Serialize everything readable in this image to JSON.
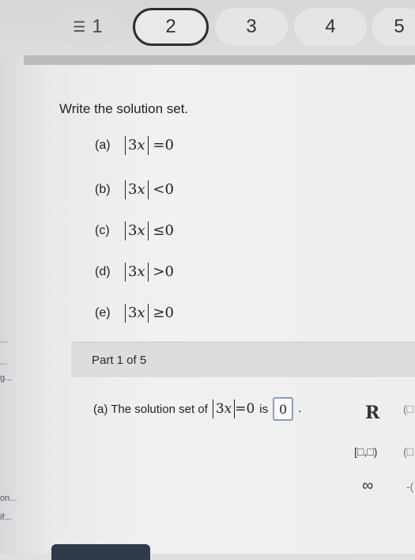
{
  "nav": {
    "menu_label": "1",
    "pages": [
      "2",
      "3",
      "4",
      "5"
    ]
  },
  "sidebar": {
    "labels": [
      "...",
      "...",
      "g...",
      "on...",
      "if..."
    ]
  },
  "question": {
    "prompt": "Write the solution set.",
    "items": [
      {
        "label": "(a)",
        "lhs": "3",
        "var": "x",
        "op": "=",
        "rhs": "0"
      },
      {
        "label": "(b)",
        "lhs": "3",
        "var": "x",
        "op": "<",
        "rhs": "0"
      },
      {
        "label": "(c)",
        "lhs": "3",
        "var": "x",
        "op": "≤",
        "rhs": "0"
      },
      {
        "label": "(d)",
        "lhs": "3",
        "var": "x",
        "op": ">",
        "rhs": "0"
      },
      {
        "label": "(e)",
        "lhs": "3",
        "var": "x",
        "op": "≥",
        "rhs": "0"
      }
    ]
  },
  "part": {
    "title": "Part 1 of 5",
    "answer_prefix": "(a) The solution set of",
    "answer_eq_lhs": "3",
    "answer_eq_var": "x",
    "answer_eq_rest": "=0",
    "answer_is": "is",
    "answer_value": "0",
    "answer_suffix": "."
  },
  "keypad": {
    "reals": "R",
    "reals_next": "(□",
    "interval": "[□,□)",
    "interval_next": "(□",
    "infinity": "∞",
    "neg": "-("
  },
  "colors": {
    "active_pill_border": "#2d2d2d",
    "answer_box_border": "#8aa0b8",
    "bottom_button": "#2f3a4a"
  }
}
